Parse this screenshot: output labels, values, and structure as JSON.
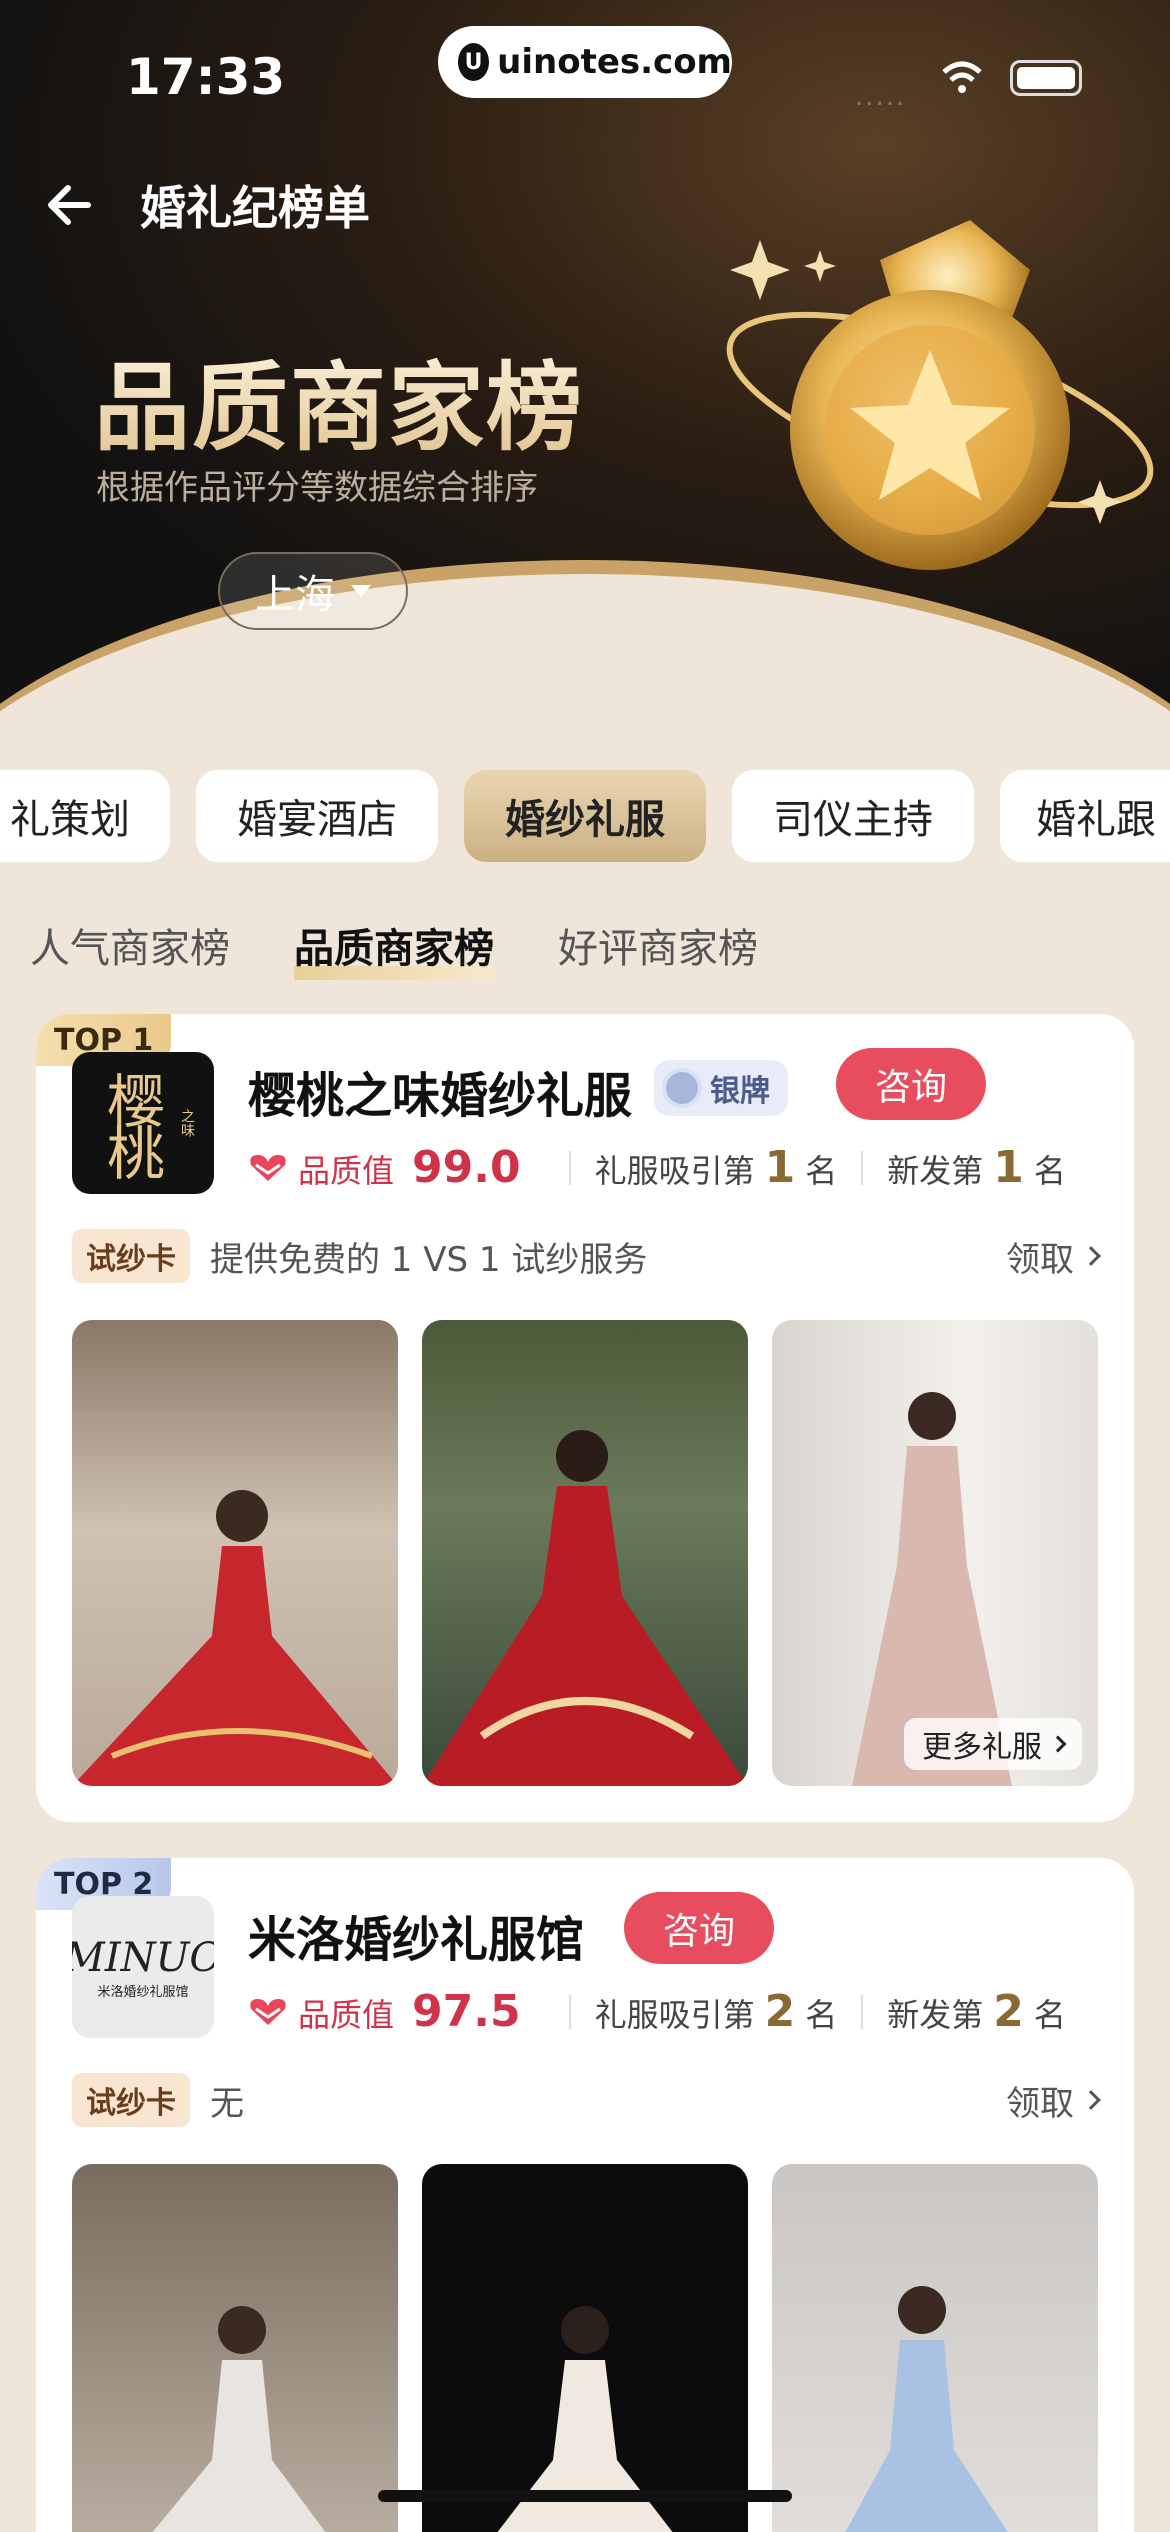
{
  "status_bar": {
    "time": "17:33",
    "url": "uinotes.com",
    "signal": "....."
  },
  "nav": {
    "title": "婚礼纪榜单"
  },
  "hero": {
    "title": "品质商家榜",
    "subtitle": "根据作品评分等数据综合排序",
    "city": "上海"
  },
  "categories": [
    "礼策划",
    "婚宴酒店",
    "婚纱礼服",
    "司仪主持",
    "婚礼跟"
  ],
  "active_category": "婚纱礼服",
  "sub_tabs": [
    "人气商家榜",
    "品质商家榜",
    "好评商家榜"
  ],
  "active_sub_tab": "品质商家榜",
  "merchants": [
    {
      "rank": "TOP 1",
      "logo_text": "樱桃",
      "logo_small": "之味",
      "name": "樱桃之味婚纱礼服",
      "tier": "银牌",
      "consult": "咨询",
      "quality_label": "品质值",
      "quality": "99.0",
      "attract_prefix": "礼服吸引第",
      "attract_rank": "1",
      "attract_suffix": "名",
      "new_prefix": "新发第",
      "new_rank": "1",
      "new_suffix": "名",
      "trial_tag": "试纱卡",
      "trial_text": "提供免费的 1 VS 1 试纱服务",
      "claim": "领取",
      "more": "更多礼服"
    },
    {
      "rank": "TOP 2",
      "logo_text": "MINUO",
      "logo_small": "米洛婚纱礼服馆",
      "name": "米洛婚纱礼服馆",
      "consult": "咨询",
      "quality_label": "品质值",
      "quality": "97.5",
      "attract_prefix": "礼服吸引第",
      "attract_rank": "2",
      "attract_suffix": "名",
      "new_prefix": "新发第",
      "new_rank": "2",
      "new_suffix": "名",
      "trial_tag": "试纱卡",
      "trial_text": "无",
      "claim": "领取"
    }
  ],
  "colors": {
    "accent_red": "#e84c5f",
    "gold": "#c9a268",
    "background": "#efe6d9"
  }
}
